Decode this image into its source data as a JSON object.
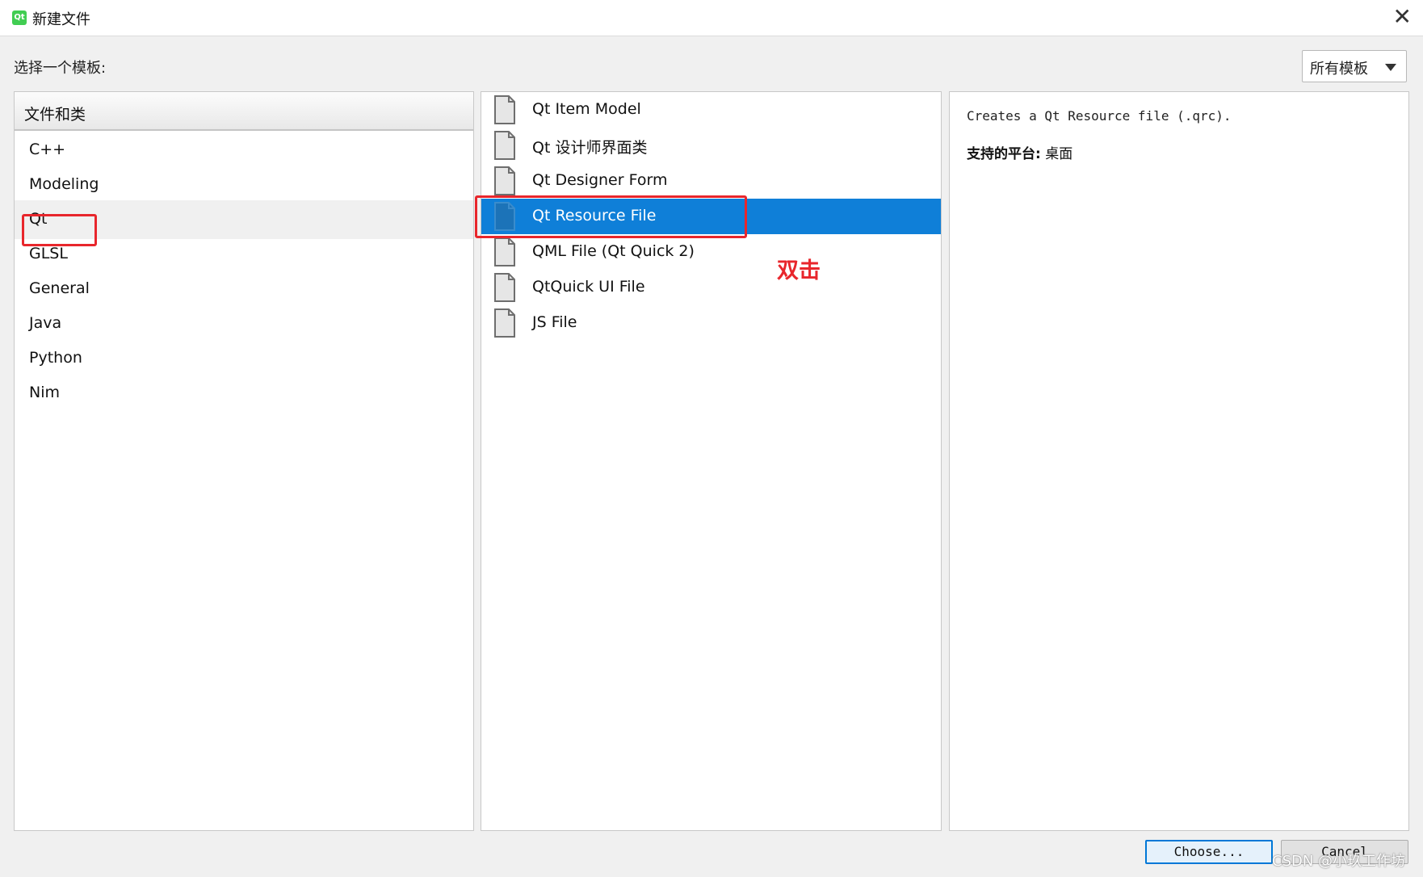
{
  "window": {
    "title": "新建文件",
    "app_icon_text": "Qt",
    "close_glyph": "✕"
  },
  "prompt_label": "选择一个模板:",
  "filter": {
    "selected": "所有模板"
  },
  "categories": {
    "header": "文件和类",
    "items": [
      {
        "label": "C++"
      },
      {
        "label": "Modeling"
      },
      {
        "label": "Qt"
      },
      {
        "label": "GLSL"
      },
      {
        "label": "General"
      },
      {
        "label": "Java"
      },
      {
        "label": "Python"
      },
      {
        "label": "Nim"
      }
    ],
    "selected_index": 2
  },
  "templates": {
    "items": [
      {
        "label": "Qt Item Model",
        "icon": "document-icon"
      },
      {
        "label": "Qt 设计师界面类",
        "icon": "document-icon"
      },
      {
        "label": "Qt Designer Form",
        "icon": "document-icon"
      },
      {
        "label": "Qt Resource File",
        "icon": "document-icon"
      },
      {
        "label": "QML File (Qt Quick 2)",
        "icon": "document-icon"
      },
      {
        "label": "QtQuick UI File",
        "icon": "document-icon"
      },
      {
        "label": "JS File",
        "icon": "document-icon"
      }
    ],
    "selected_index": 3
  },
  "details": {
    "description": "Creates a Qt Resource file (.qrc).",
    "platform_label": "支持的平台:",
    "platform_value": "桌面"
  },
  "buttons": {
    "choose": "Choose...",
    "cancel": "Cancel"
  },
  "annotation": {
    "text": "双击",
    "color": "#e8262c"
  },
  "watermark": "CSDN @小玖工作坊",
  "colors": {
    "selection": "#0f7fd8",
    "annotation": "#e8262c"
  }
}
